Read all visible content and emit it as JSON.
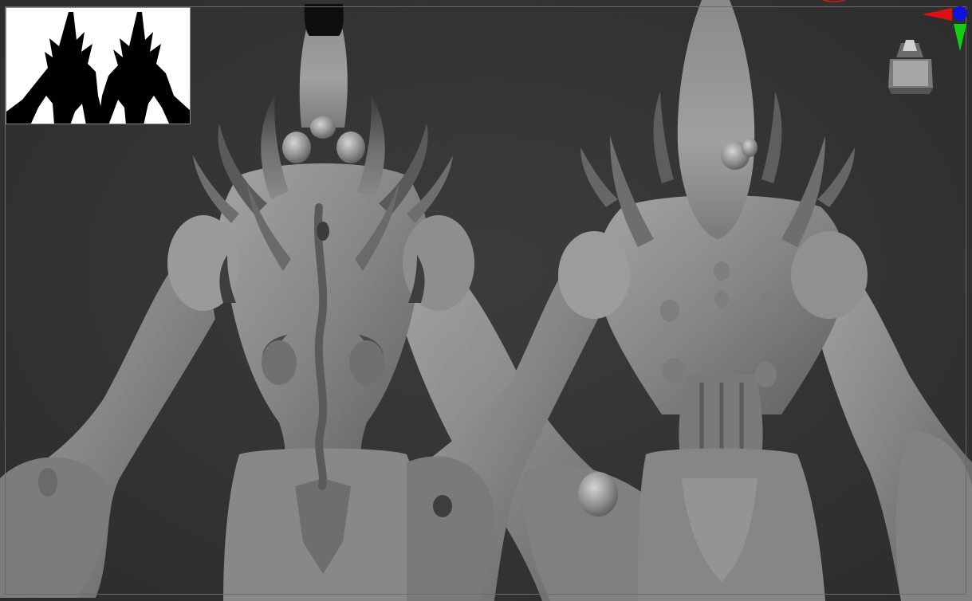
{
  "app": {
    "name": "sculpt-viewport",
    "background_color": "#333333"
  },
  "viewport": {
    "frame_color": "#6a6a6a",
    "model_color": "#8c8c8c",
    "views": [
      {
        "id": "front-view",
        "description": "front-view-sculpt"
      },
      {
        "id": "back-view",
        "description": "back-view-sculpt"
      }
    ]
  },
  "silhouette_preview": {
    "background": "#ffffff",
    "silhouette_color": "#000000",
    "figure_count": 2
  },
  "navigation_cube": {
    "icon": "navigation-cube-icon",
    "color": "#9a9a9a"
  },
  "axis_gizmo": {
    "icon": "axis-gizmo-icon",
    "x_color": "#e01010",
    "y_color": "#10d010",
    "z_color": "#1010e0"
  }
}
